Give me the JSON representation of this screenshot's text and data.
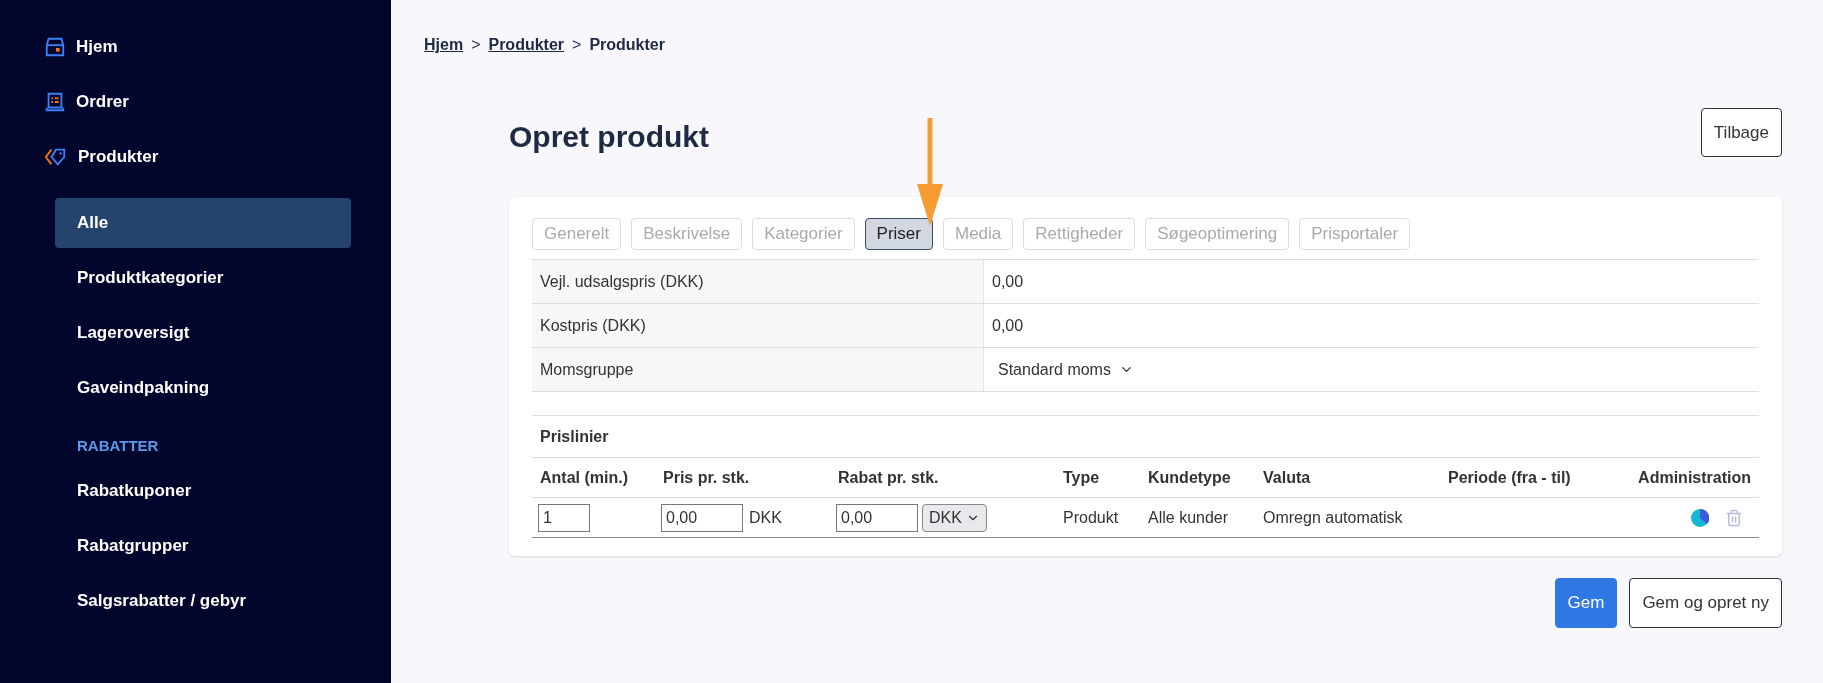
{
  "sidebar": {
    "items": [
      {
        "label": "Hjem",
        "selected": false
      },
      {
        "label": "Ordrer",
        "selected": false
      },
      {
        "label": "Produkter",
        "selected": false
      }
    ],
    "subitems": [
      {
        "label": "Alle",
        "selected": true
      },
      {
        "label": "Produktkategorier",
        "selected": false
      },
      {
        "label": "Lageroversigt",
        "selected": false
      },
      {
        "label": "Gaveindpakning",
        "selected": false
      }
    ],
    "section": {
      "title": "RABATTER",
      "items": [
        {
          "label": "Rabatkuponer",
          "selected": false
        },
        {
          "label": "Rabatgrupper",
          "selected": false
        },
        {
          "label": "Salgsrabatter / gebyr",
          "selected": false
        }
      ]
    }
  },
  "breadcrumb": [
    {
      "label": "Hjem",
      "link": true
    },
    {
      "label": "Produkter",
      "link": true
    },
    {
      "label": "Produkter",
      "link": false
    }
  ],
  "breadcrumb_separator": ">",
  "title": "Opret produkt",
  "back_button": "Tilbage",
  "tabs": [
    {
      "label": "Generelt",
      "selected": false
    },
    {
      "label": "Beskrivelse",
      "selected": false
    },
    {
      "label": "Kategorier",
      "selected": false
    },
    {
      "label": "Priser",
      "selected": true
    },
    {
      "label": "Media",
      "selected": false
    },
    {
      "label": "Rettigheder",
      "selected": false
    },
    {
      "label": "Søgeoptimering",
      "selected": false
    },
    {
      "label": "Prisportaler",
      "selected": false
    }
  ],
  "fields": [
    {
      "label": "Vejl. udsalgspris (DKK)",
      "kind": "text",
      "value": "0,00"
    },
    {
      "label": "Kostpris (DKK)",
      "kind": "text",
      "value": "0,00"
    },
    {
      "label": "Momsgruppe",
      "kind": "select",
      "value": "Standard moms"
    }
  ],
  "price_lines": {
    "title": "Prislinier",
    "columns": [
      "Antal (min.)",
      "Pris pr. stk.",
      "Rabat pr. stk.",
      "Type",
      "Kundetype",
      "Valuta",
      "Periode (fra - til)",
      "Administration"
    ],
    "rows": [
      {
        "quantity": "1",
        "price": "0,00",
        "price_currency": "DKK",
        "discount": "0,00",
        "discount_currency": "DKK",
        "type": "Produkt",
        "customer_type": "Alle kunder",
        "currency": "Omregn automatisk"
      }
    ]
  },
  "actions": [
    {
      "label": "Gem",
      "primary": true
    },
    {
      "label": "Gem og opret ny",
      "primary": false
    }
  ]
}
